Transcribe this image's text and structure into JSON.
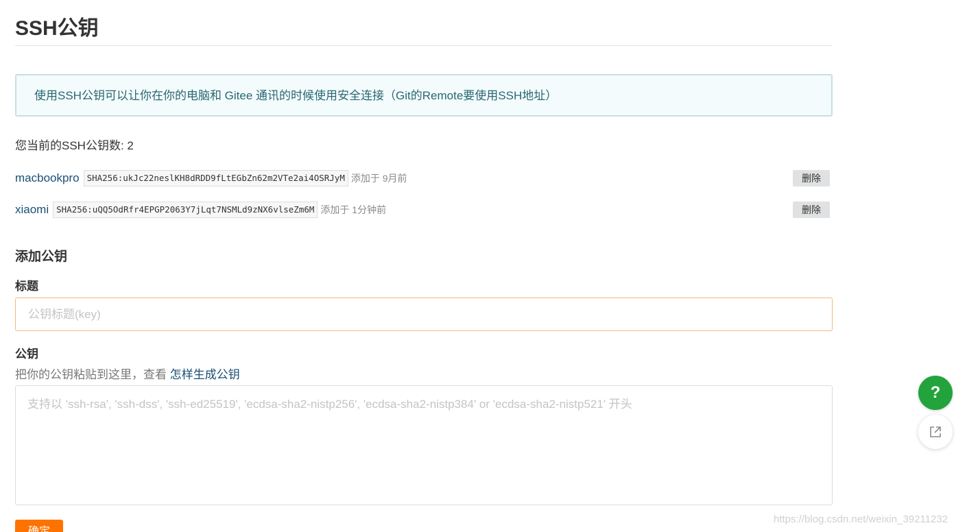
{
  "page": {
    "title": "SSH公钥"
  },
  "info": {
    "text": "使用SSH公钥可以让你在你的电脑和 Gitee 通讯的时候使用安全连接（Git的Remote要使用SSH地址）"
  },
  "keys": {
    "count_text": "您当前的SSH公钥数: 2",
    "items": [
      {
        "name": "macbookpro",
        "fingerprint": "SHA256:ukJc22neslKH8dRDD9fLtEGbZn62m2VTe2ai4OSRJyM",
        "added": "添加于 9月前",
        "delete_label": "删除"
      },
      {
        "name": "xiaomi",
        "fingerprint": "SHA256:uQQ5OdRfr4EPGP2063Y7jLqt7NSMLd9zNX6vlseZm6M",
        "added": "添加于 1分钟前",
        "delete_label": "删除"
      }
    ]
  },
  "add_form": {
    "heading": "添加公钥",
    "title_label": "标题",
    "title_placeholder": "公钥标题(key)",
    "title_value": "",
    "key_label": "公钥",
    "key_hint": "把你的公钥粘贴到这里，查看",
    "key_hint_link": "怎样生成公钥",
    "key_placeholder": "支持以 'ssh-rsa', 'ssh-dss', 'ssh-ed25519', 'ecdsa-sha2-nistp256', 'ecdsa-sha2-nistp384' or 'ecdsa-sha2-nistp521' 开头",
    "key_value": "",
    "submit_label": "确定"
  },
  "floating": {
    "help_icon": "question-mark-icon",
    "help_glyph": "?",
    "share_icon": "external-share-icon"
  },
  "watermark": "https://blog.csdn.net/weixin_39211232",
  "colors": {
    "accent_orange": "#fe7300",
    "link_blue": "#1b4f73",
    "help_green": "#23a33c",
    "info_bg": "#f4fbfd"
  }
}
